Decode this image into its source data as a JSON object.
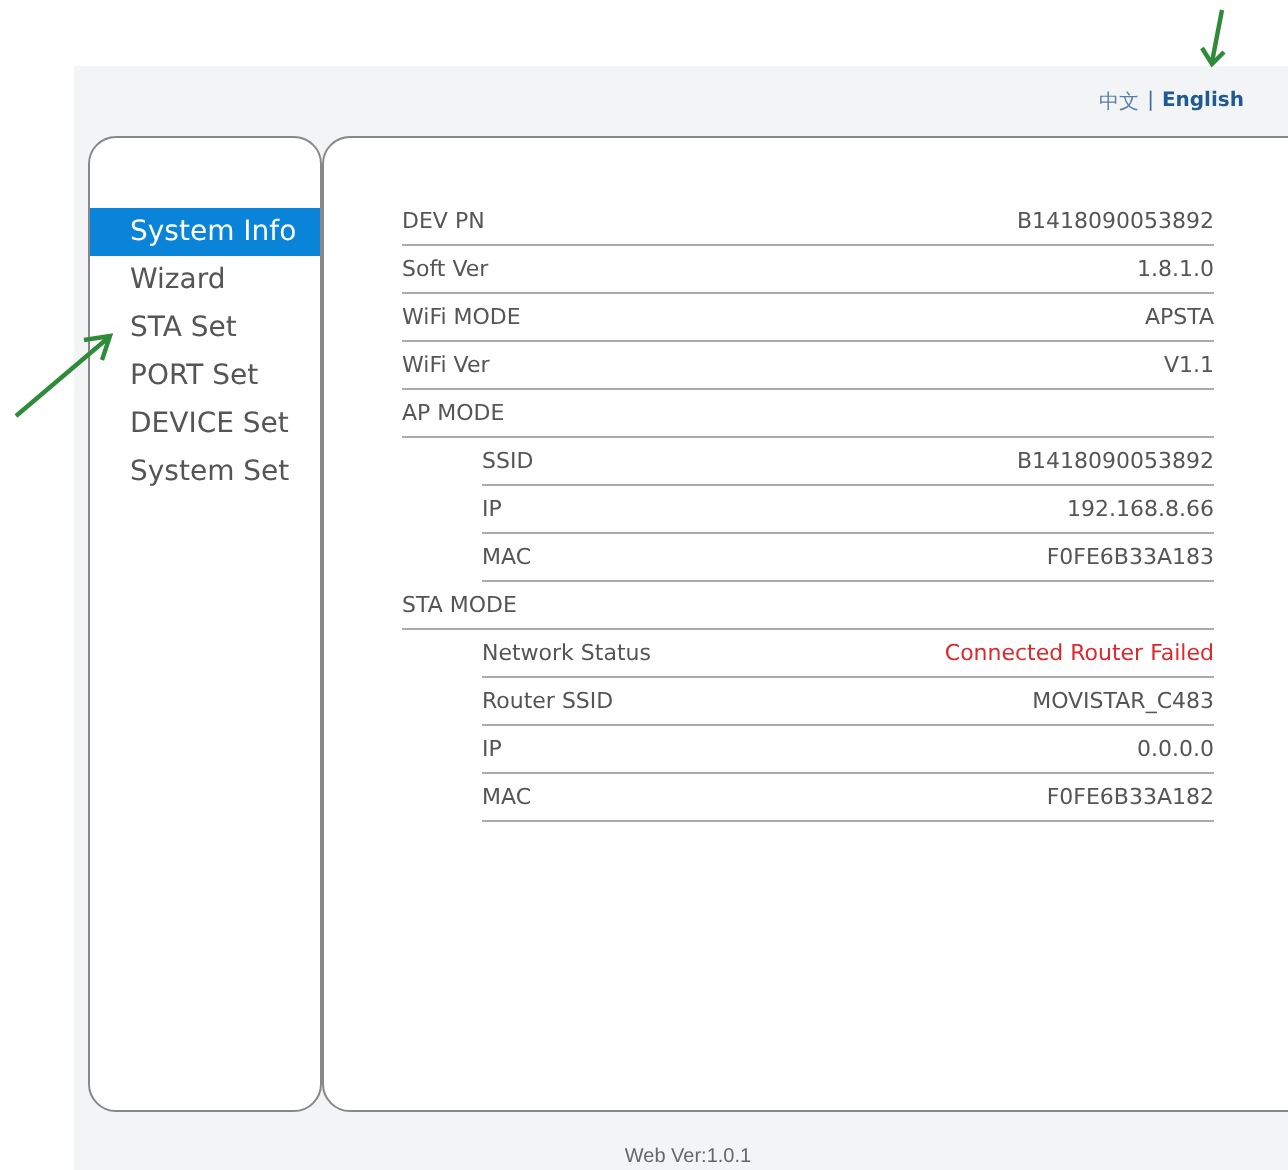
{
  "language_links": [
    {
      "label": "中文",
      "selected": false
    },
    {
      "label": "English",
      "selected": true
    }
  ],
  "language_separator": "|",
  "sidebar": {
    "items": [
      {
        "label": "System Info",
        "selected": true
      },
      {
        "label": "Wizard",
        "selected": false
      },
      {
        "label": "STA Set",
        "selected": false
      },
      {
        "label": "PORT Set",
        "selected": false
      },
      {
        "label": "DEVICE Set",
        "selected": false
      },
      {
        "label": "System Set",
        "selected": false
      }
    ]
  },
  "info_table": {
    "rows": [
      {
        "kind": "field",
        "label": "DEV PN",
        "value": "B1418090053892"
      },
      {
        "kind": "field",
        "label": "Soft Ver",
        "value": "1.8.1.0"
      },
      {
        "kind": "field",
        "label": "WiFi MODE",
        "value": "APSTA"
      },
      {
        "kind": "field",
        "label": "WiFi Ver",
        "value": "V1.1"
      },
      {
        "kind": "section",
        "label": "AP MODE",
        "children": [
          {
            "kind": "field",
            "label": "SSID",
            "value": "B1418090053892"
          },
          {
            "kind": "field",
            "label": "IP",
            "value": "192.168.8.66"
          },
          {
            "kind": "field",
            "label": "MAC",
            "value": "F0FE6B33A183"
          }
        ]
      },
      {
        "kind": "section",
        "label": "STA MODE",
        "children": [
          {
            "kind": "field",
            "label": "Network Status",
            "value": "Connected Router Failed",
            "error": true
          },
          {
            "kind": "field",
            "label": "Router SSID",
            "value": "MOVISTAR_C483"
          },
          {
            "kind": "field",
            "label": "IP",
            "value": "0.0.0.0"
          },
          {
            "kind": "field",
            "label": "MAC",
            "value": "F0FE6B33A182"
          }
        ]
      }
    ]
  },
  "footer": "Web Ver:1.0.1"
}
